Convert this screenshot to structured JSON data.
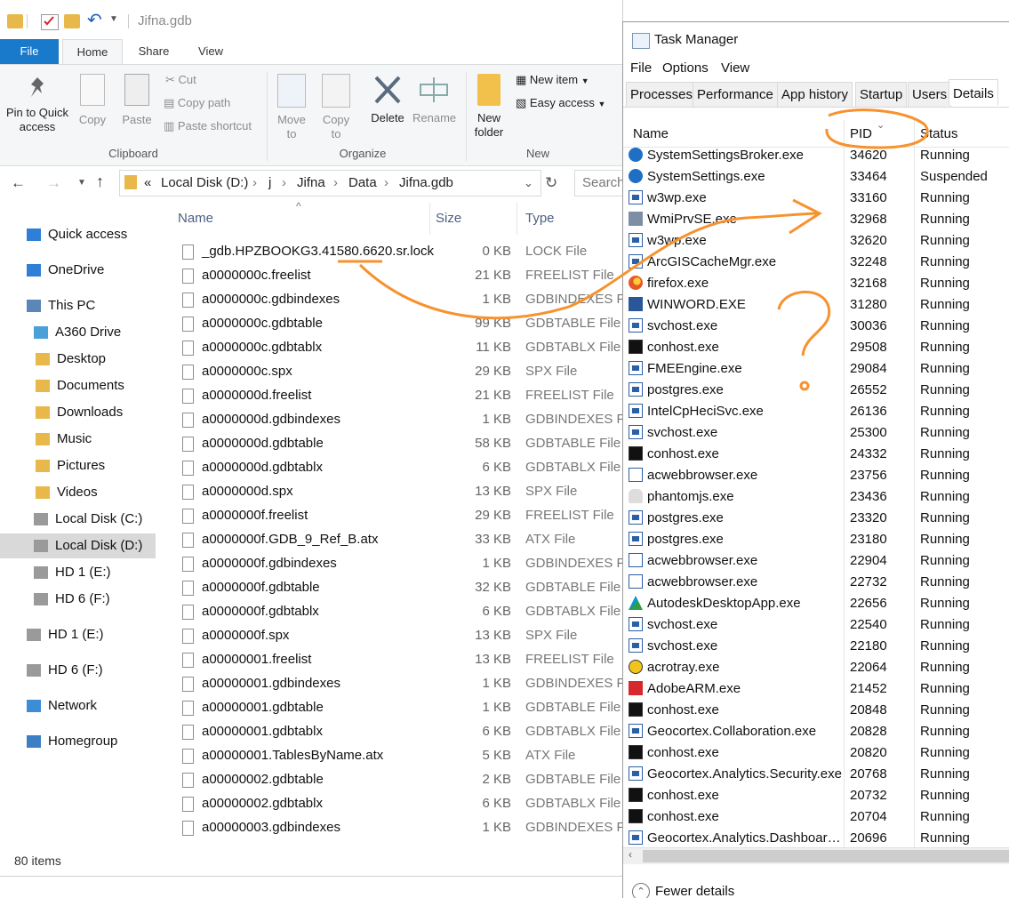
{
  "explorer": {
    "window_title": "Jifna.gdb",
    "tabs": [
      "File",
      "Home",
      "Share",
      "View"
    ],
    "ribbon": {
      "pin_label": "Pin to Quick access",
      "copy_label": "Copy",
      "paste_label": "Paste",
      "cut_label": "Cut",
      "copy_path_label": "Copy path",
      "paste_shortcut_label": "Paste shortcut",
      "move_to_label": "Move to",
      "copy_to_label": "Copy to",
      "delete_label": "Delete",
      "rename_label": "Rename",
      "new_folder_label": "New folder",
      "new_item_label": "New item",
      "easy_access_label": "Easy access",
      "groups": [
        "Clipboard",
        "Organize",
        "New"
      ]
    },
    "address": {
      "prefix": "«",
      "crumbs": [
        "Local Disk (D:)",
        "j",
        "Jifna",
        "Data",
        "Jifna.gdb"
      ],
      "search_placeholder": "Search"
    },
    "nav": [
      {
        "label": "Quick access",
        "icon": "star-icon"
      },
      {
        "label": "OneDrive",
        "icon": "cloud-icon"
      },
      {
        "label": "This PC",
        "icon": "computer-icon"
      },
      {
        "label": "A360 Drive",
        "icon": "drive-icon"
      },
      {
        "label": "Desktop",
        "icon": "folder-icon"
      },
      {
        "label": "Documents",
        "icon": "folder-icon"
      },
      {
        "label": "Downloads",
        "icon": "folder-icon"
      },
      {
        "label": "Music",
        "icon": "folder-icon"
      },
      {
        "label": "Pictures",
        "icon": "folder-icon"
      },
      {
        "label": "Videos",
        "icon": "folder-icon"
      },
      {
        "label": "Local Disk (C:)",
        "icon": "disk-icon"
      },
      {
        "label": "Local Disk (D:)",
        "icon": "disk-icon"
      },
      {
        "label": "HD 1 (E:)",
        "icon": "disk-icon"
      },
      {
        "label": "HD 6 (F:)",
        "icon": "disk-icon"
      },
      {
        "label": "HD 1 (E:)",
        "icon": "disk-icon"
      },
      {
        "label": "HD 6 (F:)",
        "icon": "disk-icon"
      },
      {
        "label": "Network",
        "icon": "network-icon"
      },
      {
        "label": "Homegroup",
        "icon": "homegroup-icon"
      }
    ],
    "columns": [
      "Name",
      "Size",
      "Type"
    ],
    "files": [
      {
        "name": "_gdb.HPZBOOKG3.41580.6620.sr.lock",
        "size": "0 KB",
        "type": "LOCK File"
      },
      {
        "name": "a0000000c.freelist",
        "size": "21 KB",
        "type": "FREELIST File"
      },
      {
        "name": "a0000000c.gdbindexes",
        "size": "1 KB",
        "type": "GDBINDEXES File"
      },
      {
        "name": "a0000000c.gdbtable",
        "size": "99 KB",
        "type": "GDBTABLE File"
      },
      {
        "name": "a0000000c.gdbtablx",
        "size": "11 KB",
        "type": "GDBTABLX File"
      },
      {
        "name": "a0000000c.spx",
        "size": "29 KB",
        "type": "SPX File"
      },
      {
        "name": "a0000000d.freelist",
        "size": "21 KB",
        "type": "FREELIST File"
      },
      {
        "name": "a0000000d.gdbindexes",
        "size": "1 KB",
        "type": "GDBINDEXES File"
      },
      {
        "name": "a0000000d.gdbtable",
        "size": "58 KB",
        "type": "GDBTABLE File"
      },
      {
        "name": "a0000000d.gdbtablx",
        "size": "6 KB",
        "type": "GDBTABLX File"
      },
      {
        "name": "a0000000d.spx",
        "size": "13 KB",
        "type": "SPX File"
      },
      {
        "name": "a0000000f.freelist",
        "size": "29 KB",
        "type": "FREELIST File"
      },
      {
        "name": "a0000000f.GDB_9_Ref_B.atx",
        "size": "33 KB",
        "type": "ATX File"
      },
      {
        "name": "a0000000f.gdbindexes",
        "size": "1 KB",
        "type": "GDBINDEXES File"
      },
      {
        "name": "a0000000f.gdbtable",
        "size": "32 KB",
        "type": "GDBTABLE File"
      },
      {
        "name": "a0000000f.gdbtablx",
        "size": "6 KB",
        "type": "GDBTABLX File"
      },
      {
        "name": "a0000000f.spx",
        "size": "13 KB",
        "type": "SPX File"
      },
      {
        "name": "a00000001.freelist",
        "size": "13 KB",
        "type": "FREELIST File"
      },
      {
        "name": "a00000001.gdbindexes",
        "size": "1 KB",
        "type": "GDBINDEXES File"
      },
      {
        "name": "a00000001.gdbtable",
        "size": "1 KB",
        "type": "GDBTABLE File"
      },
      {
        "name": "a00000001.gdbtablx",
        "size": "6 KB",
        "type": "GDBTABLX File"
      },
      {
        "name": "a00000001.TablesByName.atx",
        "size": "5 KB",
        "type": "ATX File"
      },
      {
        "name": "a00000002.gdbtable",
        "size": "2 KB",
        "type": "GDBTABLE File"
      },
      {
        "name": "a00000002.gdbtablx",
        "size": "6 KB",
        "type": "GDBTABLX File"
      },
      {
        "name": "a00000003.gdbindexes",
        "size": "1 KB",
        "type": "GDBINDEXES File"
      }
    ],
    "status": "80 items"
  },
  "taskmanager": {
    "title": "Task Manager",
    "menu": [
      "File",
      "Options",
      "View"
    ],
    "tabs": [
      "Processes",
      "Performance",
      "App history",
      "Startup",
      "Users",
      "Details"
    ],
    "active_tab": "Details",
    "columns": [
      "Name",
      "PID",
      "Status"
    ],
    "processes": [
      {
        "name": "SystemSettingsBroker.exe",
        "pid": "34620",
        "status": "Running",
        "icon": "gear"
      },
      {
        "name": "SystemSettings.exe",
        "pid": "33464",
        "status": "Suspended",
        "icon": "gear"
      },
      {
        "name": "w3wp.exe",
        "pid": "33160",
        "status": "Running",
        "icon": "window"
      },
      {
        "name": "WmiPrvSE.exe",
        "pid": "32968",
        "status": "Running",
        "icon": "wmi"
      },
      {
        "name": "w3wp.exe",
        "pid": "32620",
        "status": "Running",
        "icon": "window"
      },
      {
        "name": "ArcGISCacheMgr.exe",
        "pid": "32248",
        "status": "Running",
        "icon": "window"
      },
      {
        "name": "firefox.exe",
        "pid": "32168",
        "status": "Running",
        "icon": "firefox"
      },
      {
        "name": "WINWORD.EXE",
        "pid": "31280",
        "status": "Running",
        "icon": "word"
      },
      {
        "name": "svchost.exe",
        "pid": "30036",
        "status": "Running",
        "icon": "window"
      },
      {
        "name": "conhost.exe",
        "pid": "29508",
        "status": "Running",
        "icon": "console"
      },
      {
        "name": "FMEEngine.exe",
        "pid": "29084",
        "status": "Running",
        "icon": "window"
      },
      {
        "name": "postgres.exe",
        "pid": "26552",
        "status": "Running",
        "icon": "window"
      },
      {
        "name": "IntelCpHeciSvc.exe",
        "pid": "26136",
        "status": "Running",
        "icon": "window"
      },
      {
        "name": "svchost.exe",
        "pid": "25300",
        "status": "Running",
        "icon": "window"
      },
      {
        "name": "conhost.exe",
        "pid": "24332",
        "status": "Running",
        "icon": "console"
      },
      {
        "name": "acwebbrowser.exe",
        "pid": "23756",
        "status": "Running",
        "icon": "plain"
      },
      {
        "name": "phantomjs.exe",
        "pid": "23436",
        "status": "Running",
        "icon": "ghost"
      },
      {
        "name": "postgres.exe",
        "pid": "23320",
        "status": "Running",
        "icon": "window"
      },
      {
        "name": "postgres.exe",
        "pid": "23180",
        "status": "Running",
        "icon": "window"
      },
      {
        "name": "acwebbrowser.exe",
        "pid": "22904",
        "status": "Running",
        "icon": "plain"
      },
      {
        "name": "acwebbrowser.exe",
        "pid": "22732",
        "status": "Running",
        "icon": "plain"
      },
      {
        "name": "AutodeskDesktopApp.exe",
        "pid": "22656",
        "status": "Running",
        "icon": "autodesk"
      },
      {
        "name": "svchost.exe",
        "pid": "22540",
        "status": "Running",
        "icon": "window"
      },
      {
        "name": "svchost.exe",
        "pid": "22180",
        "status": "Running",
        "icon": "window"
      },
      {
        "name": "acrotray.exe",
        "pid": "22064",
        "status": "Running",
        "icon": "acro"
      },
      {
        "name": "AdobeARM.exe",
        "pid": "21452",
        "status": "Running",
        "icon": "pdf"
      },
      {
        "name": "conhost.exe",
        "pid": "20848",
        "status": "Running",
        "icon": "console"
      },
      {
        "name": "Geocortex.Collaboration.exe",
        "pid": "20828",
        "status": "Running",
        "icon": "window"
      },
      {
        "name": "conhost.exe",
        "pid": "20820",
        "status": "Running",
        "icon": "console"
      },
      {
        "name": "Geocortex.Analytics.Security.exe",
        "pid": "20768",
        "status": "Running",
        "icon": "window"
      },
      {
        "name": "conhost.exe",
        "pid": "20732",
        "status": "Running",
        "icon": "console"
      },
      {
        "name": "conhost.exe",
        "pid": "20704",
        "status": "Running",
        "icon": "console"
      },
      {
        "name": "Geocortex.Analytics.Dashboard....",
        "pid": "20696",
        "status": "Running",
        "icon": "window"
      }
    ],
    "fewer_details": "Fewer details"
  },
  "annotation": {
    "question_mark": "?",
    "color": "#f7922e"
  }
}
